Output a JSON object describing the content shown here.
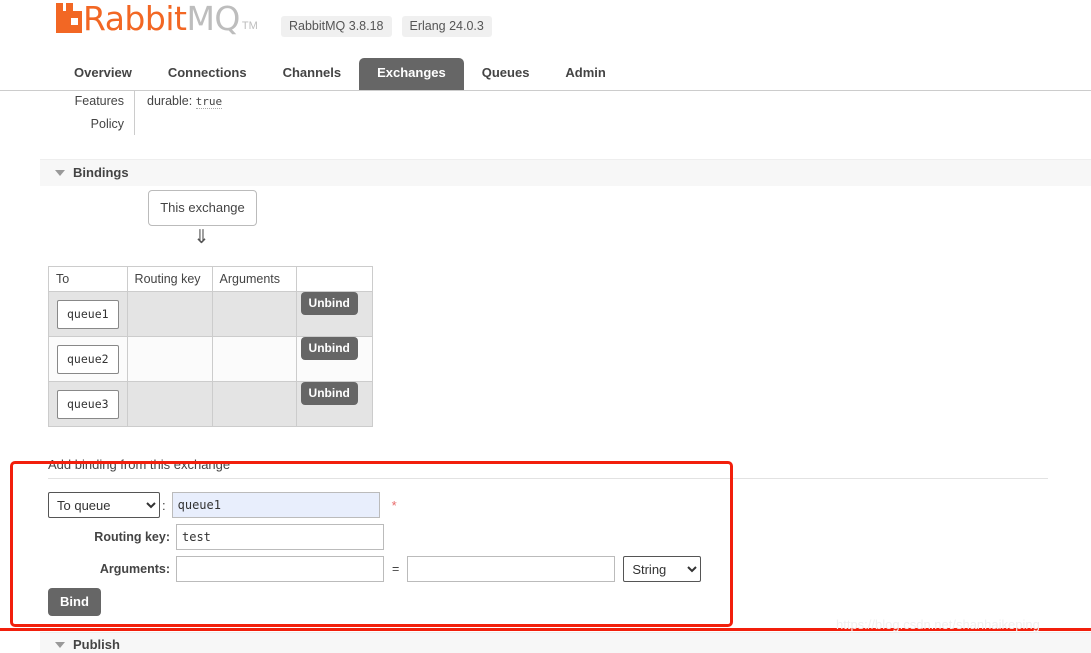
{
  "header": {
    "logo": {
      "icon": "rabbitmq-logo-icon",
      "text_primary": "Rabbit",
      "text_secondary": "MQ",
      "trademark": "TM"
    },
    "versions": [
      {
        "label": "RabbitMQ 3.8.18"
      },
      {
        "label": "Erlang 24.0.3"
      }
    ]
  },
  "nav": {
    "tabs": [
      {
        "label": "Overview",
        "active": false
      },
      {
        "label": "Connections",
        "active": false
      },
      {
        "label": "Channels",
        "active": false
      },
      {
        "label": "Exchanges",
        "active": true
      },
      {
        "label": "Queues",
        "active": false
      },
      {
        "label": "Admin",
        "active": false
      }
    ]
  },
  "details": {
    "rows": [
      {
        "key": "Features",
        "value_key": "durable:",
        "value": "true"
      },
      {
        "key": "Policy",
        "value_key": "",
        "value": ""
      }
    ]
  },
  "bindings_section": {
    "caret_icon": "triangle-down-icon",
    "title": "Bindings",
    "source_box_label": "This exchange",
    "arrow_icon": "double-down-arrow-icon",
    "table": {
      "columns": [
        "To",
        "Routing key",
        "Arguments",
        ""
      ],
      "rows": [
        {
          "to": "queue1",
          "routing_key": "",
          "arguments": "",
          "action": "Unbind"
        },
        {
          "to": "queue2",
          "routing_key": "",
          "arguments": "",
          "action": "Unbind"
        },
        {
          "to": "queue3",
          "routing_key": "",
          "arguments": "",
          "action": "Unbind"
        }
      ]
    }
  },
  "add_binding": {
    "title": "Add binding from this exchange",
    "destination": {
      "select_value": "To queue",
      "colon": ":",
      "input_value": "queue1",
      "required_marker": "*"
    },
    "routing_key": {
      "label": "Routing key:",
      "value": "test"
    },
    "arguments": {
      "label": "Arguments:",
      "key_value": "",
      "equals": "=",
      "val_value": "",
      "type_value": "String"
    },
    "submit_label": "Bind"
  },
  "publish_section": {
    "caret_icon": "triangle-down-icon",
    "title": "Publish"
  },
  "annotation": {
    "highlight_color": "#f21f0c",
    "watermark": "https://blog.csdn.net/shanhaikeping"
  }
}
